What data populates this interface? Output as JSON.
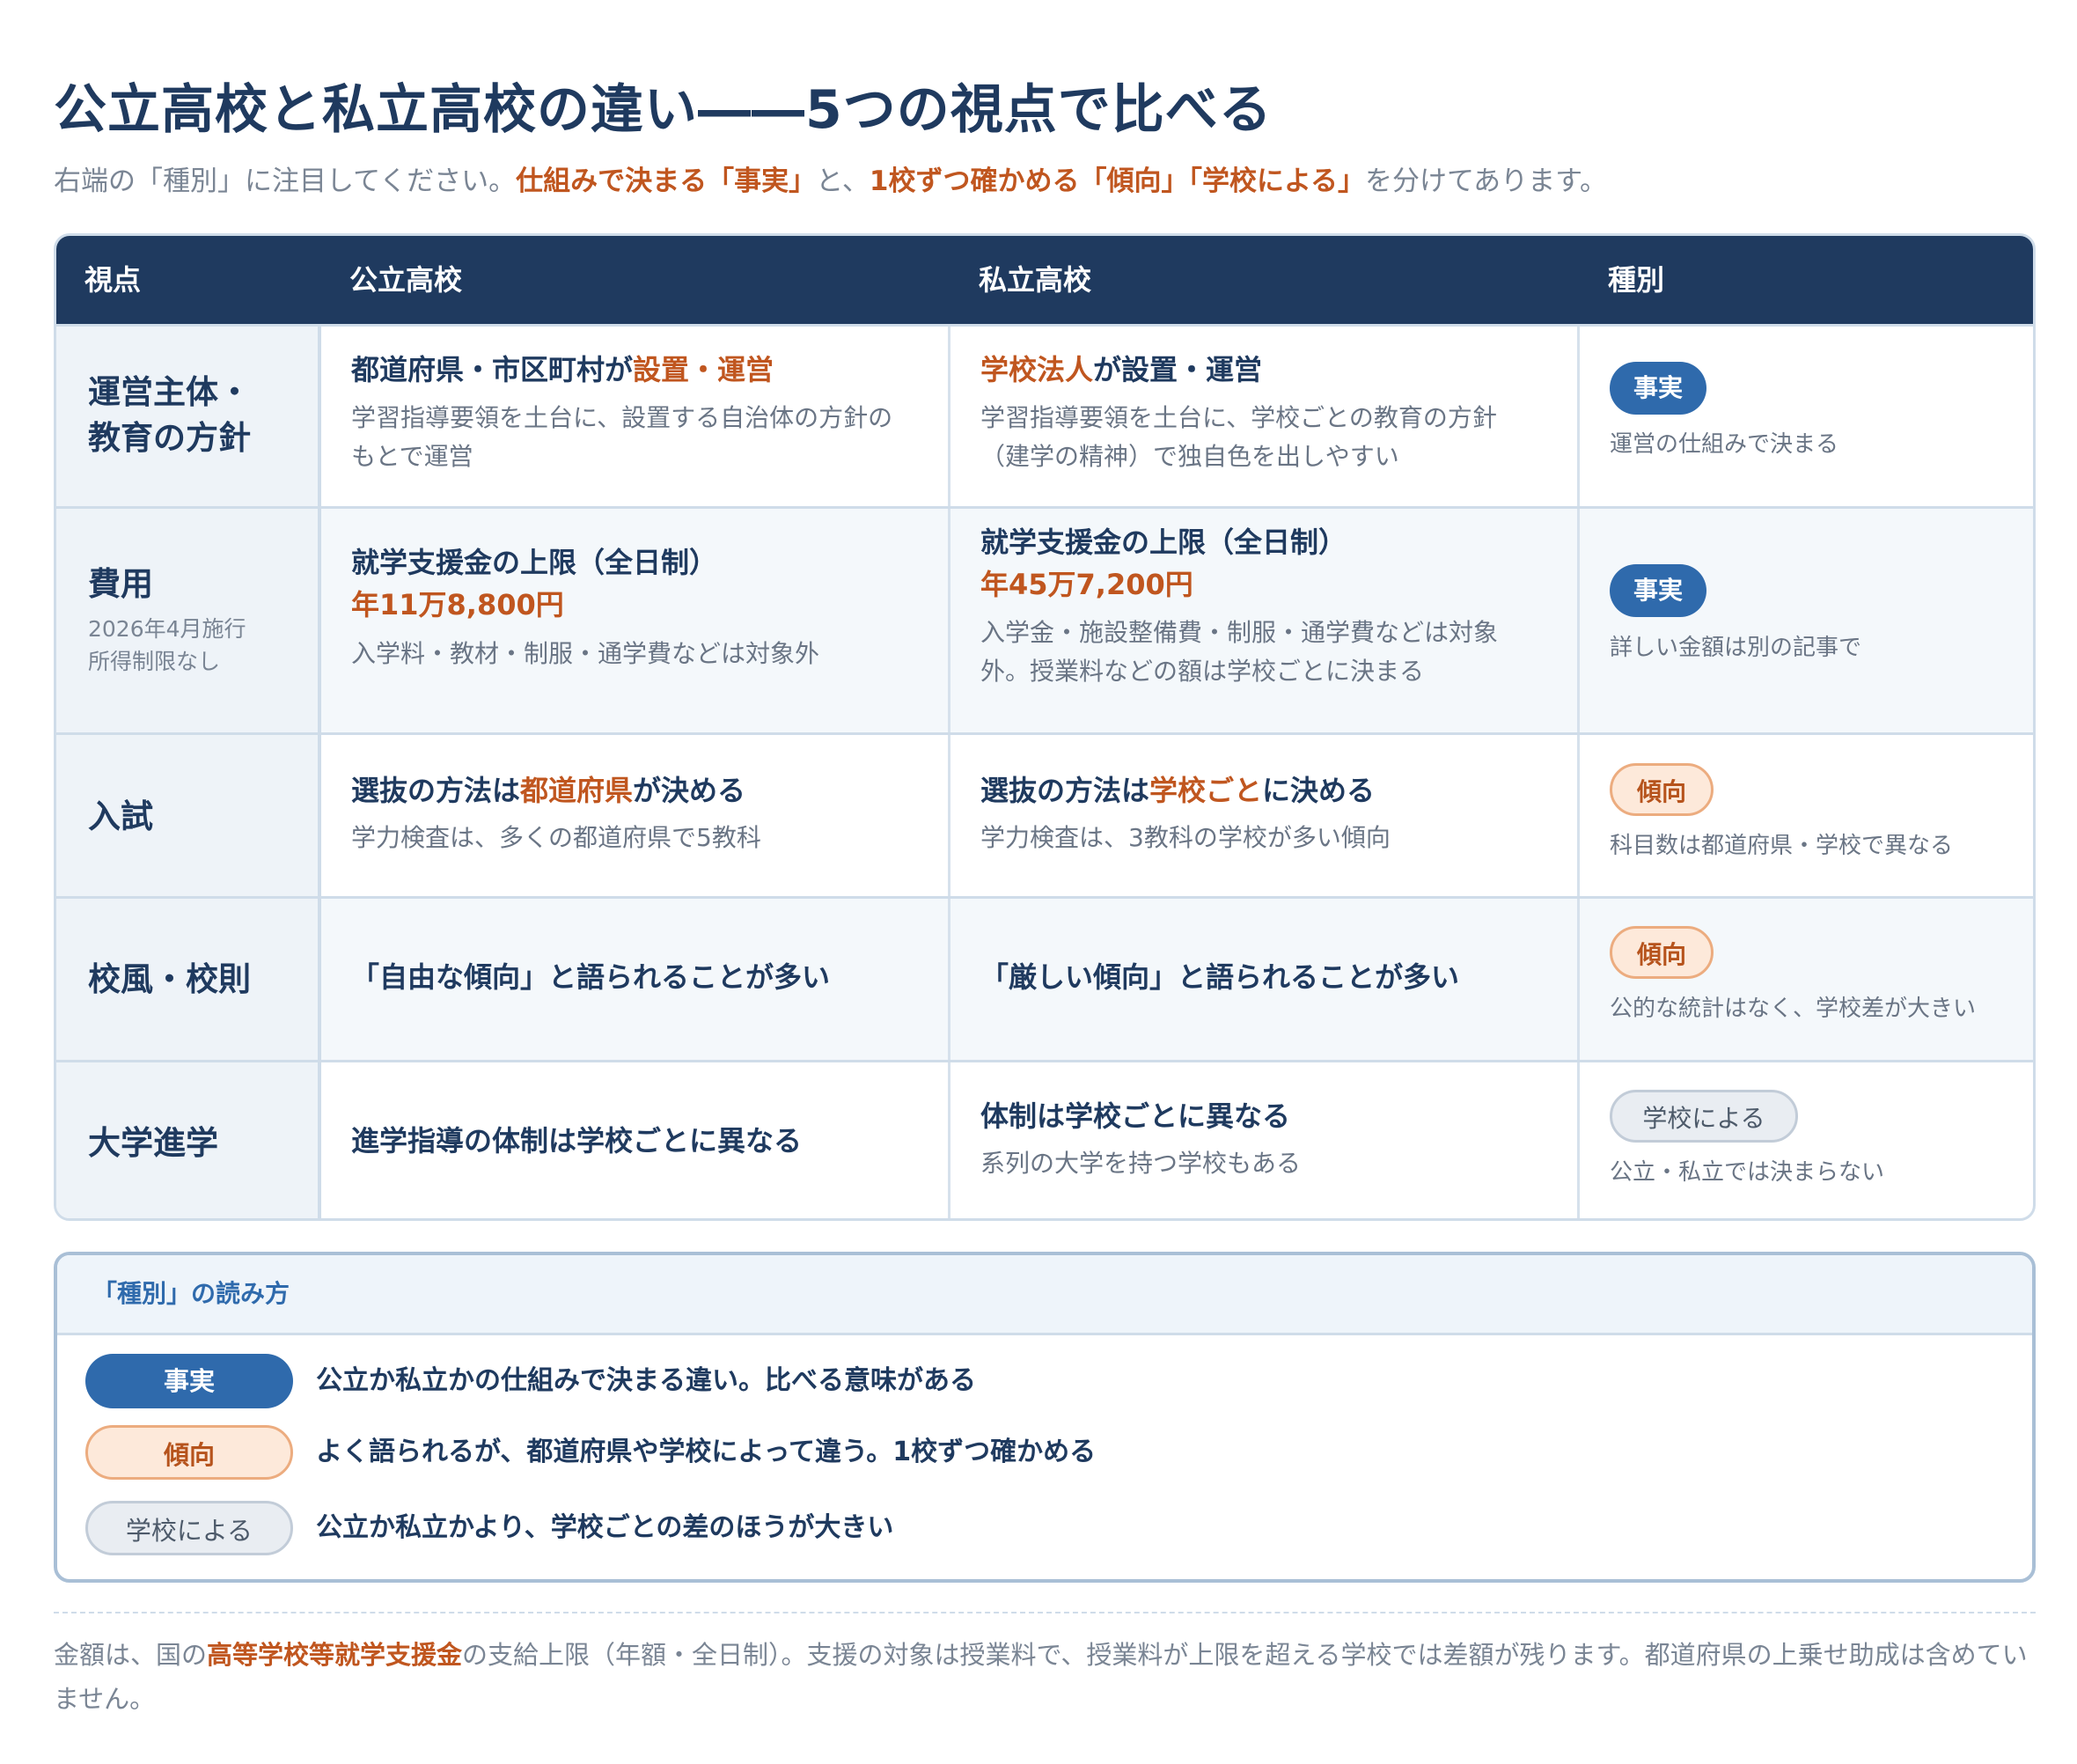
{
  "title": "公立高校と私立高校の違い――5つの視点で比べる",
  "subtitle": {
    "pre": "右端の「種別」に注目してください。",
    "hl1": "仕組みで決まる「事実」",
    "mid": "と、",
    "hl2": "1校ずつ確かめる「傾向」「学校による」",
    "post": "を分けてあります。"
  },
  "table": {
    "headers": [
      "視点",
      "公立高校",
      "私立高校",
      "種別"
    ],
    "rows": [
      {
        "label_l1": "運営主体・",
        "label_l2": "教育の方針",
        "public": {
          "main_pre": "都道府県・市区町村が",
          "main_hl": "設置・運営",
          "sub1": "学習指導要領を土台に、設置する自治体の方針の",
          "sub2": "もとで運営"
        },
        "private": {
          "main_hl": "学校法人",
          "main_post": "が設置・運営",
          "sub1": "学習指導要領を土台に、学校ごとの教育の方針",
          "sub2": "（建学の精神）で独自色を出しやすい"
        },
        "type": {
          "badge": "事実",
          "note": "運営の仕組みで決まる"
        }
      },
      {
        "label": "費用",
        "note1": "2026年4月施行",
        "note2": "所得制限なし",
        "public": {
          "main": "就学支援金の上限（全日制）",
          "amount": "年11万8,800円",
          "sub1": "入学料・教材・制服・通学費などは対象外"
        },
        "private": {
          "main": "就学支援金の上限（全日制）",
          "amount": "年45万7,200円",
          "sub1": "入学金・施設整備費・制服・通学費などは対象",
          "sub2": "外。授業料などの額は学校ごとに決まる"
        },
        "type": {
          "badge": "事実",
          "note": "詳しい金額は別の記事で"
        }
      },
      {
        "label": "入試",
        "public": {
          "main_pre": "選抜の方法は",
          "main_hl": "都道府県",
          "main_post": "が決める",
          "sub1": "学力検査は、多くの都道府県で5教科"
        },
        "private": {
          "main_pre": "選抜の方法は",
          "main_hl": "学校ごと",
          "main_post": "に決める",
          "sub1": "学力検査は、3教科の学校が多い傾向"
        },
        "type": {
          "badge": "傾向",
          "note": "科目数は都道府県・学校で異なる"
        }
      },
      {
        "label": "校風・校則",
        "public": {
          "main": "「自由な傾向」と語られることが多い"
        },
        "private": {
          "main": "「厳しい傾向」と語られることが多い"
        },
        "type": {
          "badge": "傾向",
          "note": "公的な統計はなく、学校差が大きい"
        }
      },
      {
        "label": "大学進学",
        "public": {
          "main": "進学指導の体制は学校ごとに異なる"
        },
        "private": {
          "main": "体制は学校ごとに異なる",
          "sub1": "系列の大学を持つ学校もある"
        },
        "type": {
          "badge": "学校による",
          "note": "公立・私立では決まらない"
        }
      }
    ]
  },
  "legend": {
    "title": "「種別」の読み方",
    "items": [
      {
        "badge": "事実",
        "text": "公立か私立かの仕組みで決まる違い。比べる意味がある"
      },
      {
        "badge": "傾向",
        "text": "よく語られるが、都道府県や学校によって違う。1校ずつ確かめる"
      },
      {
        "badge": "学校による",
        "text": "公立か私立かより、学校ごとの差のほうが大きい"
      }
    ]
  },
  "footnote": {
    "pre": "金額は、国の",
    "hl": "高等学校等就学支援金",
    "post": "の支給上限（年額・全日制）。支援の対象は授業料で、授業料が上限を超える学校では差額が残ります。都道府県の上乗せ助成は含めていません。"
  },
  "colors": {
    "navy": "#1f3a5f",
    "accent_orange": "#c0561f",
    "fact_blue": "#2f6aac",
    "trend_bg": "#fde9da",
    "school_bg": "#e9edf2"
  }
}
